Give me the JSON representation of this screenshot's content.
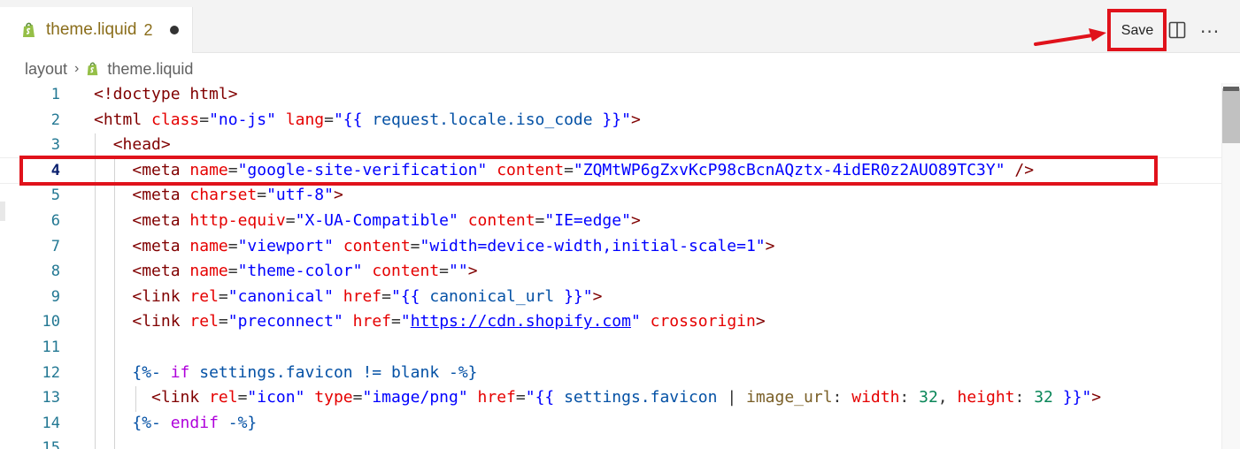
{
  "tab": {
    "title": "theme.liquid",
    "badge": "2",
    "icon": "shopify-icon"
  },
  "toolbar": {
    "save_label": "Save",
    "split_icon": "split-editor-icon",
    "more_label": "···"
  },
  "breadcrumb": {
    "folder": "layout",
    "file": "theme.liquid"
  },
  "colors": {
    "annotation_red": "#e0121b",
    "tag": "#800000",
    "attr": "#e50000",
    "string": "#0000ff",
    "liquid": "#0451a5",
    "keyword": "#af00db",
    "line_number": "#237893"
  },
  "editor": {
    "active_line": 4,
    "lines": [
      {
        "n": "1",
        "tokens": [
          [
            "tag",
            "<!doctype html>"
          ]
        ]
      },
      {
        "n": "2",
        "tokens": [
          [
            "tag",
            "<html "
          ],
          [
            "attr",
            "class"
          ],
          [
            "pun",
            "="
          ],
          [
            "str",
            "\"no-js\" "
          ],
          [
            "attr",
            "lang"
          ],
          [
            "pun",
            "="
          ],
          [
            "str",
            "\"{{ "
          ],
          [
            "liq",
            "request.locale.iso_code"
          ],
          [
            "str",
            " }}\""
          ],
          [
            "tag",
            ">"
          ]
        ]
      },
      {
        "n": "3",
        "tokens": [
          [
            "pun",
            "  "
          ],
          [
            "tag",
            "<head>"
          ]
        ]
      },
      {
        "n": "4",
        "tokens": [
          [
            "pun",
            "    "
          ],
          [
            "tag",
            "<meta "
          ],
          [
            "attr",
            "name"
          ],
          [
            "pun",
            "="
          ],
          [
            "str",
            "\"google-site-verification\" "
          ],
          [
            "attr",
            "content"
          ],
          [
            "pun",
            "="
          ],
          [
            "str",
            "\"ZQMtWP6gZxvKcP98cBcnAQztx-4idER0z2AUO89TC3Y\""
          ],
          [
            "tag",
            " />"
          ]
        ]
      },
      {
        "n": "5",
        "tokens": [
          [
            "pun",
            "    "
          ],
          [
            "tag",
            "<meta "
          ],
          [
            "attr",
            "charset"
          ],
          [
            "pun",
            "="
          ],
          [
            "str",
            "\"utf-8\""
          ],
          [
            "tag",
            ">"
          ]
        ]
      },
      {
        "n": "6",
        "tokens": [
          [
            "pun",
            "    "
          ],
          [
            "tag",
            "<meta "
          ],
          [
            "attr",
            "http-equiv"
          ],
          [
            "pun",
            "="
          ],
          [
            "str",
            "\"X-UA-Compatible\" "
          ],
          [
            "attr",
            "content"
          ],
          [
            "pun",
            "="
          ],
          [
            "str",
            "\"IE=edge\""
          ],
          [
            "tag",
            ">"
          ]
        ]
      },
      {
        "n": "7",
        "tokens": [
          [
            "pun",
            "    "
          ],
          [
            "tag",
            "<meta "
          ],
          [
            "attr",
            "name"
          ],
          [
            "pun",
            "="
          ],
          [
            "str",
            "\"viewport\" "
          ],
          [
            "attr",
            "content"
          ],
          [
            "pun",
            "="
          ],
          [
            "str",
            "\"width=device-width,initial-scale=1\""
          ],
          [
            "tag",
            ">"
          ]
        ]
      },
      {
        "n": "8",
        "tokens": [
          [
            "pun",
            "    "
          ],
          [
            "tag",
            "<meta "
          ],
          [
            "attr",
            "name"
          ],
          [
            "pun",
            "="
          ],
          [
            "str",
            "\"theme-color\" "
          ],
          [
            "attr",
            "content"
          ],
          [
            "pun",
            "="
          ],
          [
            "str",
            "\"\""
          ],
          [
            "tag",
            ">"
          ]
        ]
      },
      {
        "n": "9",
        "tokens": [
          [
            "pun",
            "    "
          ],
          [
            "tag",
            "<link "
          ],
          [
            "attr",
            "rel"
          ],
          [
            "pun",
            "="
          ],
          [
            "str",
            "\"canonical\" "
          ],
          [
            "attr",
            "href"
          ],
          [
            "pun",
            "="
          ],
          [
            "str",
            "\"{{ "
          ],
          [
            "liq",
            "canonical_url"
          ],
          [
            "str",
            " }}\""
          ],
          [
            "tag",
            ">"
          ]
        ]
      },
      {
        "n": "10",
        "tokens": [
          [
            "pun",
            "    "
          ],
          [
            "tag",
            "<link "
          ],
          [
            "attr",
            "rel"
          ],
          [
            "pun",
            "="
          ],
          [
            "str",
            "\"preconnect\" "
          ],
          [
            "attr",
            "href"
          ],
          [
            "pun",
            "="
          ],
          [
            "str",
            "\""
          ],
          [
            "link",
            "https://cdn.shopify.com"
          ],
          [
            "str",
            "\" "
          ],
          [
            "attr",
            "crossorigin"
          ],
          [
            "tag",
            ">"
          ]
        ]
      },
      {
        "n": "11",
        "tokens": []
      },
      {
        "n": "12",
        "tokens": [
          [
            "pun",
            "    "
          ],
          [
            "liq",
            "{%- "
          ],
          [
            "kw",
            "if "
          ],
          [
            "liq",
            "settings.favicon != blank -%}"
          ]
        ]
      },
      {
        "n": "13",
        "tokens": [
          [
            "pun",
            "      "
          ],
          [
            "tag",
            "<link "
          ],
          [
            "attr",
            "rel"
          ],
          [
            "pun",
            "="
          ],
          [
            "str",
            "\"icon\" "
          ],
          [
            "attr",
            "type"
          ],
          [
            "pun",
            "="
          ],
          [
            "str",
            "\"image/png\" "
          ],
          [
            "attr",
            "href"
          ],
          [
            "pun",
            "="
          ],
          [
            "str",
            "\"{{ "
          ],
          [
            "liq",
            "settings.favicon"
          ],
          [
            "pun",
            " | "
          ],
          [
            "fn",
            "image_url"
          ],
          [
            "pun",
            ": "
          ],
          [
            "attr",
            "width"
          ],
          [
            "pun",
            ": "
          ],
          [
            "num",
            "32"
          ],
          [
            "pun",
            ", "
          ],
          [
            "attr",
            "height"
          ],
          [
            "pun",
            ": "
          ],
          [
            "num",
            "32"
          ],
          [
            "str",
            " }}\""
          ],
          [
            "tag",
            ">"
          ]
        ]
      },
      {
        "n": "14",
        "tokens": [
          [
            "pun",
            "    "
          ],
          [
            "liq",
            "{%- "
          ],
          [
            "kw",
            "endif "
          ],
          [
            "liq",
            "-%}"
          ]
        ]
      },
      {
        "n": "15",
        "tokens": []
      }
    ]
  }
}
